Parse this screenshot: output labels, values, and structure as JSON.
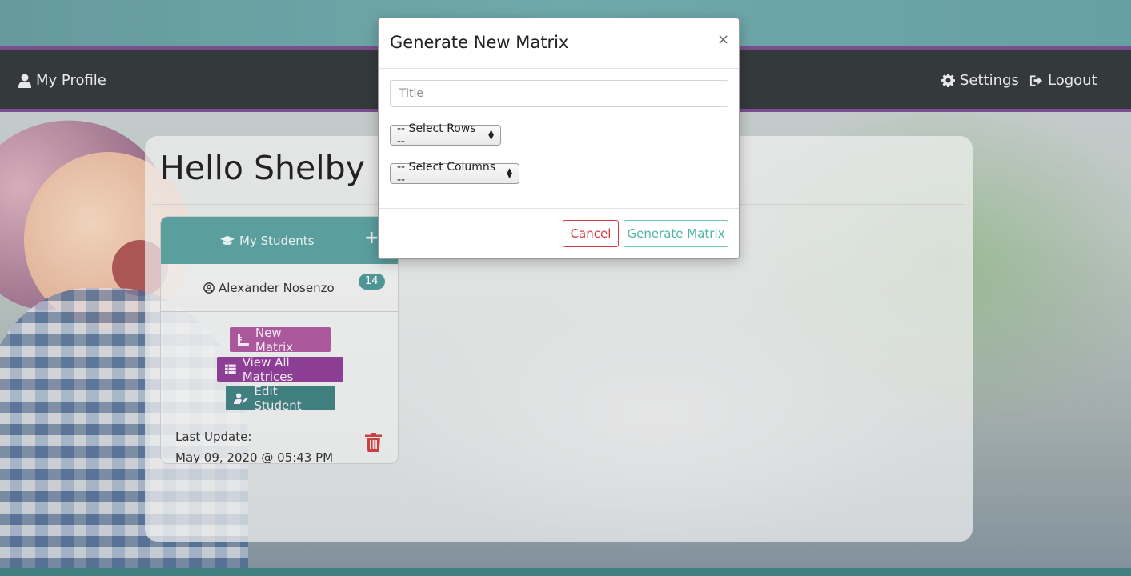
{
  "navbar": {
    "profile_label": "My Profile",
    "settings_label": "Settings",
    "logout_label": "Logout"
  },
  "main": {
    "greeting": "Hello Shelby Pa"
  },
  "students_panel": {
    "title": "My Students",
    "add_symbol": "+",
    "student": {
      "name": "Alexander Nosenzo",
      "badge_count": "14",
      "new_matrix_label": "New Matrix",
      "view_all_label": "View All Matrices",
      "edit_label": "Edit Student",
      "last_update_label": "Last Update:",
      "last_update_value": "May 09, 2020 @ 05:43 PM"
    }
  },
  "modal": {
    "title": "Generate New Matrix",
    "close_symbol": "×",
    "title_placeholder": "Title",
    "title_value": "",
    "rows_select": "-- Select Rows --",
    "columns_select": "-- Select Columns --",
    "cancel_label": "Cancel",
    "generate_label": "Generate Matrix"
  },
  "colors": {
    "navbar_bg": "#343a3c",
    "navbar_accent": "#7d4e8f",
    "panel_header": "#5a9e9d",
    "new_matrix_btn": "#a9589b",
    "view_all_btn": "#8b3e93",
    "edit_btn": "#3f7f7e",
    "cancel": "#d8383f",
    "generate": "#4fb5a5"
  },
  "icons": {
    "profile": "user-icon",
    "settings": "gear-icon",
    "logout": "sign-out-icon",
    "students": "graduation-cap-icon",
    "student": "user-circle-icon",
    "new_matrix": "ruler-icon",
    "view_all": "table-icon",
    "edit": "user-edit-icon",
    "delete": "trash-icon"
  }
}
